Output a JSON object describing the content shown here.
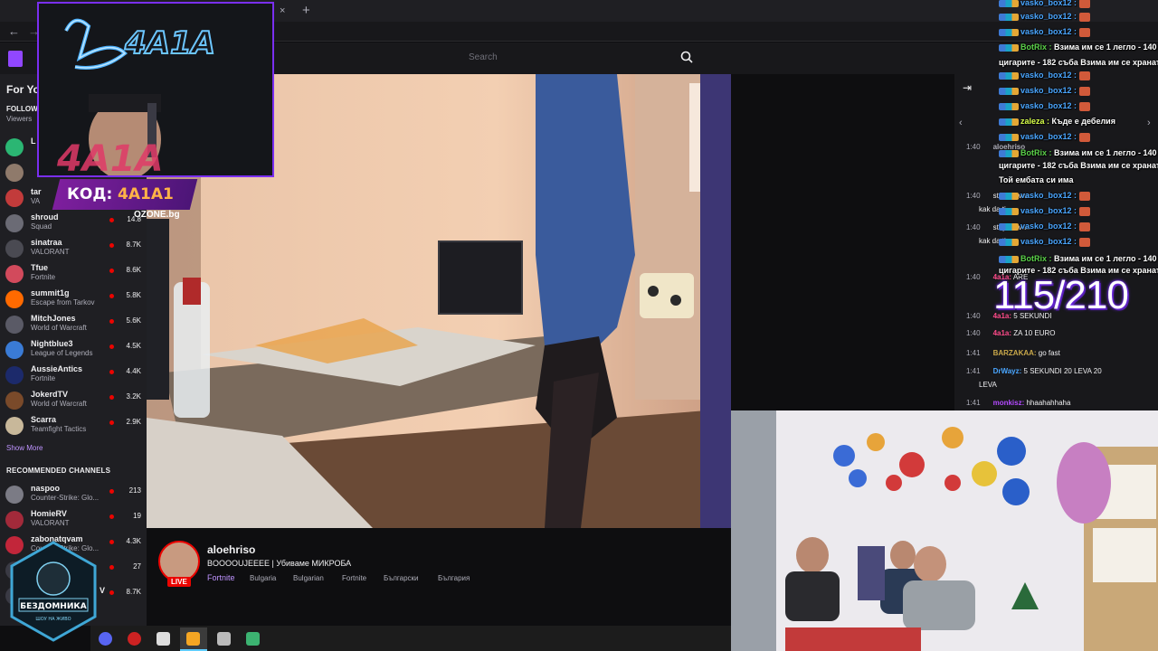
{
  "browser": {
    "tab_close": "×",
    "tab_new": "+",
    "back": "←",
    "forward": "→"
  },
  "twitch": {
    "search_placeholder": "Search"
  },
  "sidebar": {
    "for_you": "For Yo",
    "followed_heading": "FOLLOWE",
    "viewers_label": "Viewers",
    "channels": [
      {
        "name": "L",
        "game": "",
        "viewers": "",
        "color": "#2bb673"
      },
      {
        "name": "",
        "game": "",
        "viewers": "",
        "color": "#8f7a6b"
      },
      {
        "name": "tar",
        "game": "VA",
        "viewers": "",
        "color": "#c23b3b"
      },
      {
        "name": "shroud",
        "game": "Squad",
        "viewers": "14.8",
        "color": "#6b6b75"
      },
      {
        "name": "sinatraa",
        "game": "VALORANT",
        "viewers": "8.7K",
        "color": "#4a4a52"
      },
      {
        "name": "Tfue",
        "game": "Fortnite",
        "viewers": "8.6K",
        "color": "#d24a5c"
      },
      {
        "name": "summit1g",
        "game": "Escape from Tarkov",
        "viewers": "5.8K",
        "color": "#ff6a00"
      },
      {
        "name": "MitchJones",
        "game": "World of Warcraft",
        "viewers": "5.6K",
        "color": "#5a5a66"
      },
      {
        "name": "Nightblue3",
        "game": "League of Legends",
        "viewers": "4.5K",
        "color": "#3a7bd5"
      },
      {
        "name": "AussieAntics",
        "game": "Fortnite",
        "viewers": "4.4K",
        "color": "#1c2a6b"
      },
      {
        "name": "JokerdTV",
        "game": "World of Warcraft",
        "viewers": "3.2K",
        "color": "#7a4a2a"
      },
      {
        "name": "Scarra",
        "game": "Teamfight Tactics",
        "viewers": "2.9K",
        "color": "#c8b89a"
      }
    ],
    "show_more": "Show More",
    "recommended_heading": "RECOMMENDED CHANNELS",
    "recommended": [
      {
        "name": "naspoo",
        "game": "Counter-Strike: Glo...",
        "viewers": "213",
        "color": "#7b7b85"
      },
      {
        "name": "HomieRV",
        "game": "VALORANT",
        "viewers": "19",
        "color": "#a22a3a"
      },
      {
        "name": "zabonatqvam",
        "game": "Counter-Strike: Glo...",
        "viewers": "4.3K",
        "color": "#c2263a"
      },
      {
        "name": "",
        "game": "",
        "viewers": "27",
        "color": "#3a3a44"
      },
      {
        "name": "",
        "game": "",
        "viewers": "8.7K",
        "color": "#3a3a44"
      }
    ],
    "partial_v": "V"
  },
  "stream": {
    "channel_name": "aloehriso",
    "title": "BOOOOUJEEEE | Убиваме МИКРОБА",
    "game": "Fortnite",
    "live": "LIVE",
    "tags": [
      "Bulgaria",
      "Bulgarian",
      "Fortnite",
      "Български",
      "България"
    ]
  },
  "overlay": {
    "kod_label": "КОД:",
    "kod_code": "4A1A1",
    "sponsor": "OZONE.bg",
    "counter": "115/210",
    "logo_text": "БЕЗДОМНИКА",
    "logo_sub": "ШОУ НА ЖИВО"
  },
  "overlay_chat": [
    {
      "user": "vasko_box12 :",
      "text": "",
      "color": "#4aa6ff",
      "emote": true
    },
    {
      "user": "vasko_box12 :",
      "text": "",
      "color": "#4aa6ff",
      "emote": true
    },
    {
      "user": "vasko_box12 :",
      "text": "",
      "color": "#4aa6ff",
      "emote": true
    },
    {
      "user": "BotRix :",
      "text": " Взима им се 1 легло - 140 с",
      "color": "#5bd14a",
      "emote": false
    },
    {
      "user": "",
      "text": "цигарите - 182 съба Взима им се хранат",
      "color": "#ffffff",
      "emote": false
    },
    {
      "user": "vasko_box12 :",
      "text": "",
      "color": "#4aa6ff",
      "emote": true
    },
    {
      "user": "vasko_box12 :",
      "text": "",
      "color": "#4aa6ff",
      "emote": true
    },
    {
      "user": "vasko_box12 :",
      "text": "",
      "color": "#4aa6ff",
      "emote": true
    },
    {
      "user": "zaleza :",
      "text": " Къде е дебелия",
      "color": "#d8ff4a",
      "emote": false
    },
    {
      "user": "vasko_box12 :",
      "text": "",
      "color": "#4aa6ff",
      "emote": true
    },
    {
      "user": "BotRix :",
      "text": " Взима им се 1 легло - 140 с",
      "color": "#5bd14a",
      "emote": false
    },
    {
      "user": "",
      "text": "цигарите - 182 съба Взима им се хранат",
      "color": "#ffffff",
      "emote": false
    },
    {
      "user": "",
      "text": "Той ембата си има",
      "color": "#ffffff",
      "emote": false
    },
    {
      "user": "vasko_box12 :",
      "text": "",
      "color": "#4aa6ff",
      "emote": true
    },
    {
      "user": "vasko_box12 :",
      "text": "",
      "color": "#4aa6ff",
      "emote": true
    },
    {
      "user": "vasko_box12 :",
      "text": "",
      "color": "#4aa6ff",
      "emote": true
    },
    {
      "user": "vasko_box12 :",
      "text": "",
      "color": "#4aa6ff",
      "emote": true
    },
    {
      "user": "BotRix :",
      "text": " Взима им се 1 легло - 140 с",
      "color": "#5bd14a",
      "emote": false
    },
    {
      "user": "",
      "text": "цигарите - 182 съба Взима им се хранат",
      "color": "#ffffff",
      "emote": false
    }
  ],
  "twitch_chat": [
    {
      "time": "1:40",
      "user": "aloehriso",
      "text": "",
      "color": "#adadb8"
    },
    {
      "time": "1:40",
      "user": "",
      "text": "stoyanovaa",
      "color": "#adadb8"
    },
    {
      "time": "",
      "user": "",
      "text": "kak da ti",
      "color": "#adadb8"
    },
    {
      "time": "1:40",
      "user": "",
      "text": "stoyanovaa",
      "color": "#adadb8"
    },
    {
      "time": "",
      "user": "",
      "text": "kak da ti",
      "color": "#adadb8"
    },
    {
      "time": "1:40",
      "user": "4a1a:",
      "text": " ARE",
      "color": "#ff4a8a"
    },
    {
      "time": "1:40",
      "user": "4a1a:",
      "text": " 5 SEKUNDI",
      "color": "#ff4a8a"
    },
    {
      "time": "1:40",
      "user": "4a1a:",
      "text": " ZA 10 EURO",
      "color": "#ff4a8a"
    },
    {
      "time": "1:41",
      "user": "BARZAKAA:",
      "text": " go fast",
      "color": "#c9a84a"
    },
    {
      "time": "1:41",
      "user": "DrWayz:",
      "text": " 5 SEKUNDI 20 LEVA 20",
      "color": "#4aa6ff"
    },
    {
      "time": "",
      "user": "",
      "text": "LEVA",
      "color": "#efeff1"
    },
    {
      "time": "1:41",
      "user": "monkisz:",
      "text": " hhaahahhaha",
      "color": "#b44aff"
    }
  ]
}
